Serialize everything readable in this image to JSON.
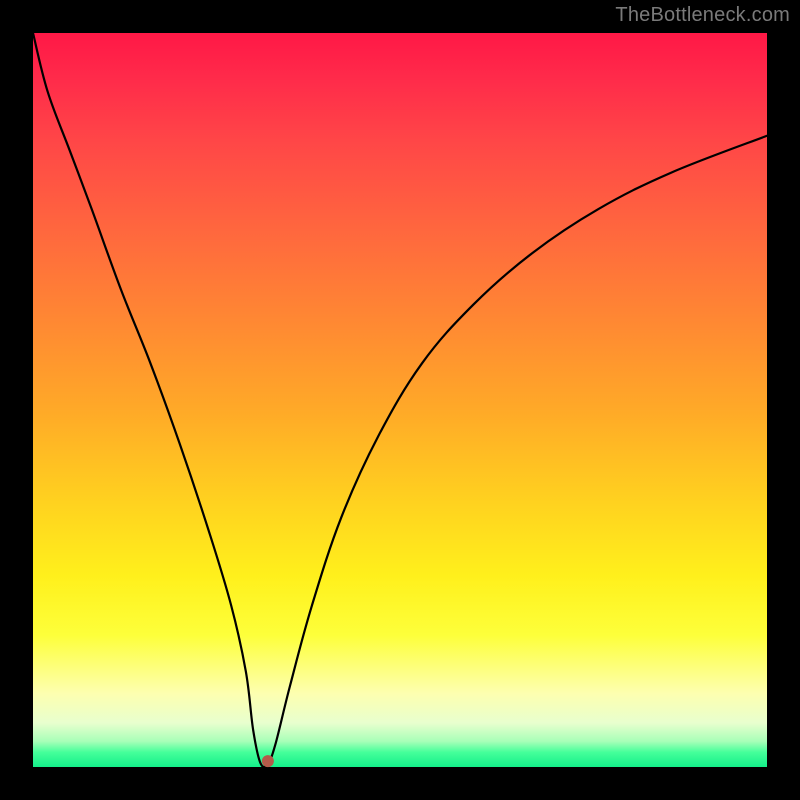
{
  "attribution": "TheBottleneck.com",
  "chart_data": {
    "type": "line",
    "title": "",
    "xlabel": "",
    "ylabel": "",
    "xlim": [
      0,
      100
    ],
    "ylim": [
      0,
      100
    ],
    "grid": false,
    "legend": false,
    "series": [
      {
        "name": "bottleneck-curve",
        "x": [
          0,
          2,
          5,
          8,
          12,
          16,
          20,
          24,
          27,
          29,
          30,
          31,
          32,
          33,
          35,
          38,
          42,
          47,
          53,
          60,
          68,
          77,
          87,
          100
        ],
        "y": [
          100,
          92,
          84,
          76,
          65,
          55,
          44,
          32,
          22,
          13,
          5,
          0.5,
          0.5,
          3,
          11,
          22,
          34,
          45,
          55,
          63,
          70,
          76,
          81,
          86
        ]
      }
    ],
    "marker": {
      "x": 32,
      "y": 0.8,
      "color": "#b45a4a",
      "radius_px": 6
    },
    "note": "Values read from pixel positions; chart has no visible axes, ticks, or labels."
  },
  "colors": {
    "frame": "#000000",
    "curve": "#000000",
    "marker": "#b45a4a",
    "attribution": "#7a7a7a"
  }
}
